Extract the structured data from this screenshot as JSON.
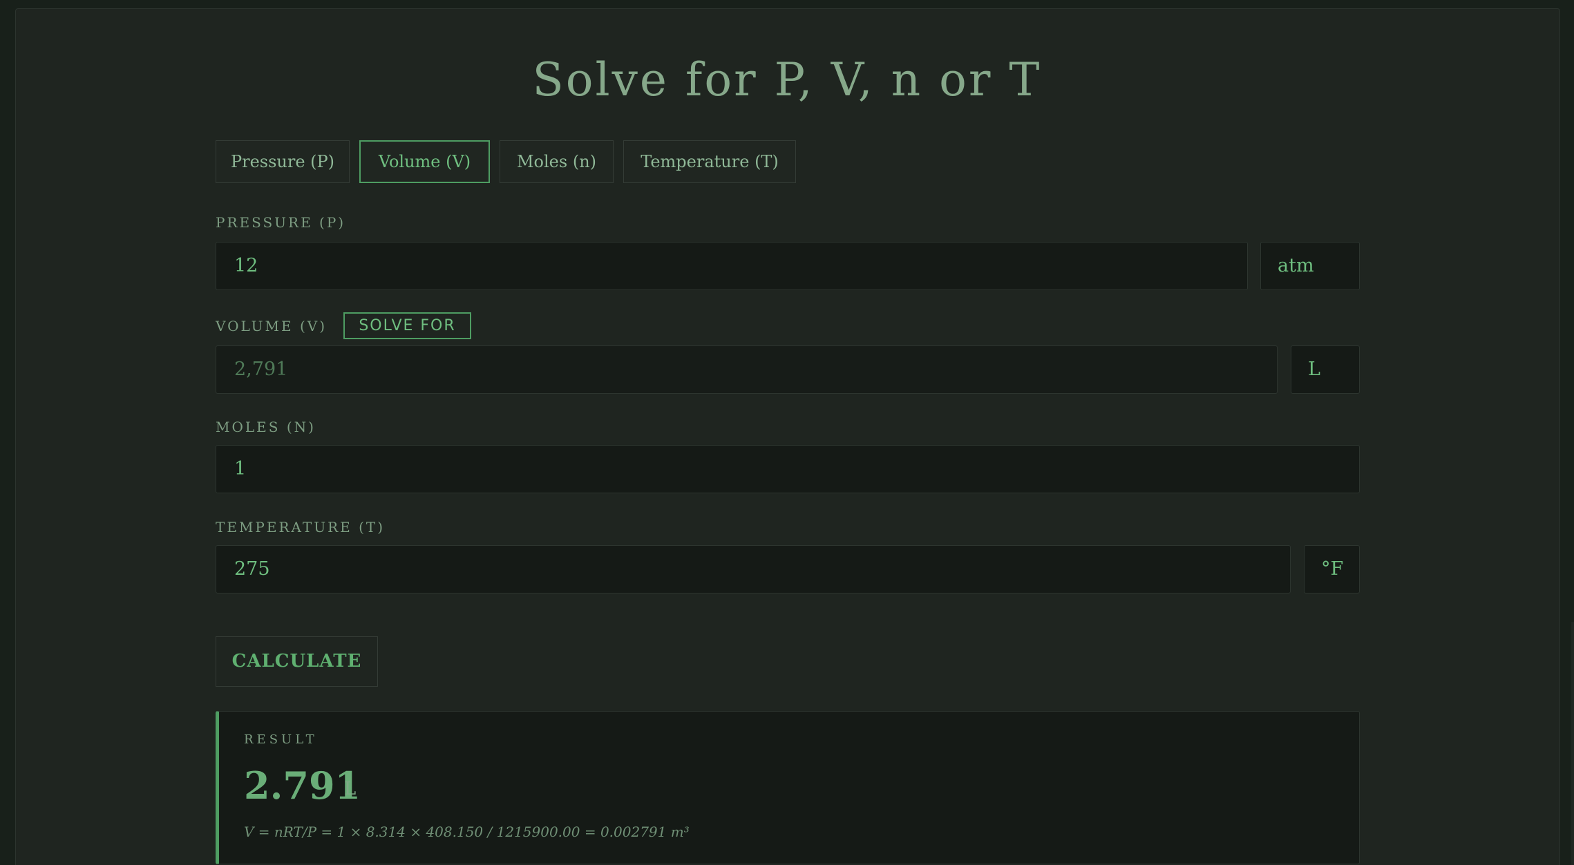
{
  "title": "Solve for P, V, n or T",
  "tabs": [
    {
      "label": "Pressure (P)",
      "active": false
    },
    {
      "label": "Volume (V)",
      "active": true
    },
    {
      "label": "Moles (n)",
      "active": false
    },
    {
      "label": "Temperature (T)",
      "active": false
    }
  ],
  "fields": {
    "pressure": {
      "label": "PRESSURE (P)",
      "value": "12",
      "unit": "atm"
    },
    "volume": {
      "label": "VOLUME (V)",
      "badge": "SOLVE FOR",
      "value": "2,791",
      "unit": "L"
    },
    "moles": {
      "label": "MOLES (N)",
      "value": "1"
    },
    "temperature": {
      "label": "TEMPERATURE (T)",
      "value": "275",
      "unit": "°F"
    }
  },
  "calculate_label": "CALCULATE",
  "result": {
    "label": "RESULT",
    "value": "2.791",
    "unit": "L",
    "formula": "V = nRT/P = 1 × 8.314 × 408.150 / 1215900.00 = 0.002791 m³"
  },
  "colors": {
    "accent": "#4e9d62",
    "background": "#1f2520",
    "input_background": "#151a16"
  }
}
